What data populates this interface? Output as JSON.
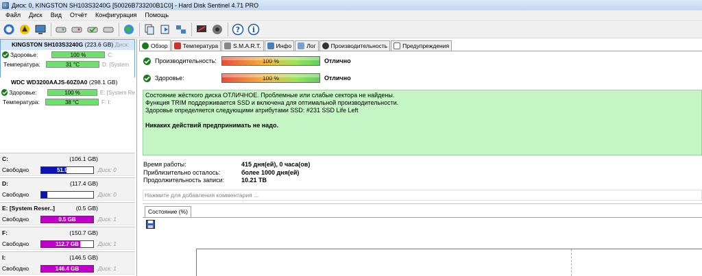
{
  "window": {
    "title": "Диск: 0, KINGSTON SH103S3240G [50026B733200B1C0]  -  Hard Disk Sentinel 4.71 PRO"
  },
  "menu": [
    "Файл",
    "Диск",
    "Вид",
    "Отчёт",
    "Конфигурация",
    "Помощь"
  ],
  "disks": [
    {
      "name": "KINGSTON SH103S3240G",
      "size": "(223.6 GB)",
      "extra": "Диск:",
      "health_label": "Здоровье:",
      "health": "100 %",
      "health_suffix": "C:",
      "temp_label": "Температура:",
      "temp": "31 °C",
      "temp_suffix": "D: [System"
    },
    {
      "name": "WDC WD3200AAJS-60Z0A0",
      "size": "(298.1 GB)",
      "extra": "",
      "health_label": "Здоровье:",
      "health": "100 %",
      "health_suffix": "E: [System Re",
      "temp_label": "Температура:",
      "temp": "38 °C",
      "temp_suffix": "F: I:"
    }
  ],
  "volumes": [
    {
      "name": "C:",
      "size": "(106.1 GB)",
      "free_label": "Свободно",
      "free": "51.9 GB",
      "disk": "Диск: 0",
      "fill": 0.49,
      "color": "#0a14b0"
    },
    {
      "name": "D:",
      "size": "(117.4 GB)",
      "free_label": "Свободно",
      "free": "14.1 GB",
      "disk": "Диск: 0",
      "fill": 0.12,
      "color": "#0a14b0"
    },
    {
      "name": "E: [System Reser..]",
      "size": "(0.5 GB)",
      "free_label": "Свободно",
      "free": "0.5 GB",
      "disk": "Диск: 1",
      "fill": 1.0,
      "color": "#c000c8"
    },
    {
      "name": "F:",
      "size": "(150.7 GB)",
      "free_label": "Свободно",
      "free": "112.7 GB",
      "disk": "Диск: 1",
      "fill": 0.75,
      "color": "#c000c8"
    },
    {
      "name": "I:",
      "size": "(146.5 GB)",
      "free_label": "Свободно",
      "free": "146.4 GB",
      "disk": "Диск: 1",
      "fill": 1.0,
      "color": "#c000c8"
    }
  ],
  "tabs": [
    "Обзор",
    "Температура",
    "S.M.A.R.T.",
    "Инфо",
    "Лог",
    "Производительность",
    "Предупреждения"
  ],
  "overview": {
    "perf_label": "Производительность:",
    "perf_value": "100 %",
    "perf_result": "Отлично",
    "health_label": "Здоровье:",
    "health_value": "100 %",
    "health_result": "Отлично",
    "lines": [
      "Состояние жёсткого диска ОТЛИЧНОЕ. Проблемные или слабые сектора не найдены.",
      "Функция TRIM поддерживается SSD и включена для оптимальной производительности.",
      "Здоровье определяется следующими атрибутами SSD: #231 SSD Life Left"
    ],
    "action": "Никаких действий предпринимать не надо.",
    "uptime_label": "Время работы:",
    "uptime": "415 дня(ей), 0 часа(ов)",
    "remaining_label": "Приблизительно осталось:",
    "remaining": "более 1000 дня(ей)",
    "writes_label": "Продолжительность записи:",
    "writes": "10.21 TB",
    "comment_placeholder": "Нажмите для добавления комментария ...",
    "graph_tab": "Состояние (%)"
  }
}
